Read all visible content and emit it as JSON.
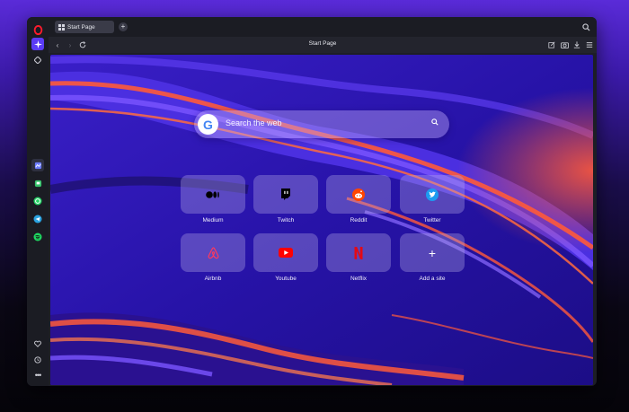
{
  "tab": {
    "label": "Start Page"
  },
  "toolbar": {
    "address": "Start Page"
  },
  "search": {
    "placeholder": "Search the web",
    "logo": "G"
  },
  "speed_dial": [
    {
      "label": "Medium",
      "icon": "medium-icon"
    },
    {
      "label": "Twitch",
      "icon": "twitch-icon"
    },
    {
      "label": "Reddit",
      "icon": "reddit-icon"
    },
    {
      "label": "Twitter",
      "icon": "twitter-icon"
    },
    {
      "label": "Airbnb",
      "icon": "airbnb-icon"
    },
    {
      "label": "Youtube",
      "icon": "youtube-icon"
    },
    {
      "label": "Netflix",
      "icon": "netflix-icon"
    },
    {
      "label": "Add a site",
      "icon": "plus-icon"
    }
  ],
  "colors": {
    "accent": "#5b3cf5",
    "opera_red": "#ff1b2d",
    "wallpaper_orange": "#ff5a3a"
  }
}
